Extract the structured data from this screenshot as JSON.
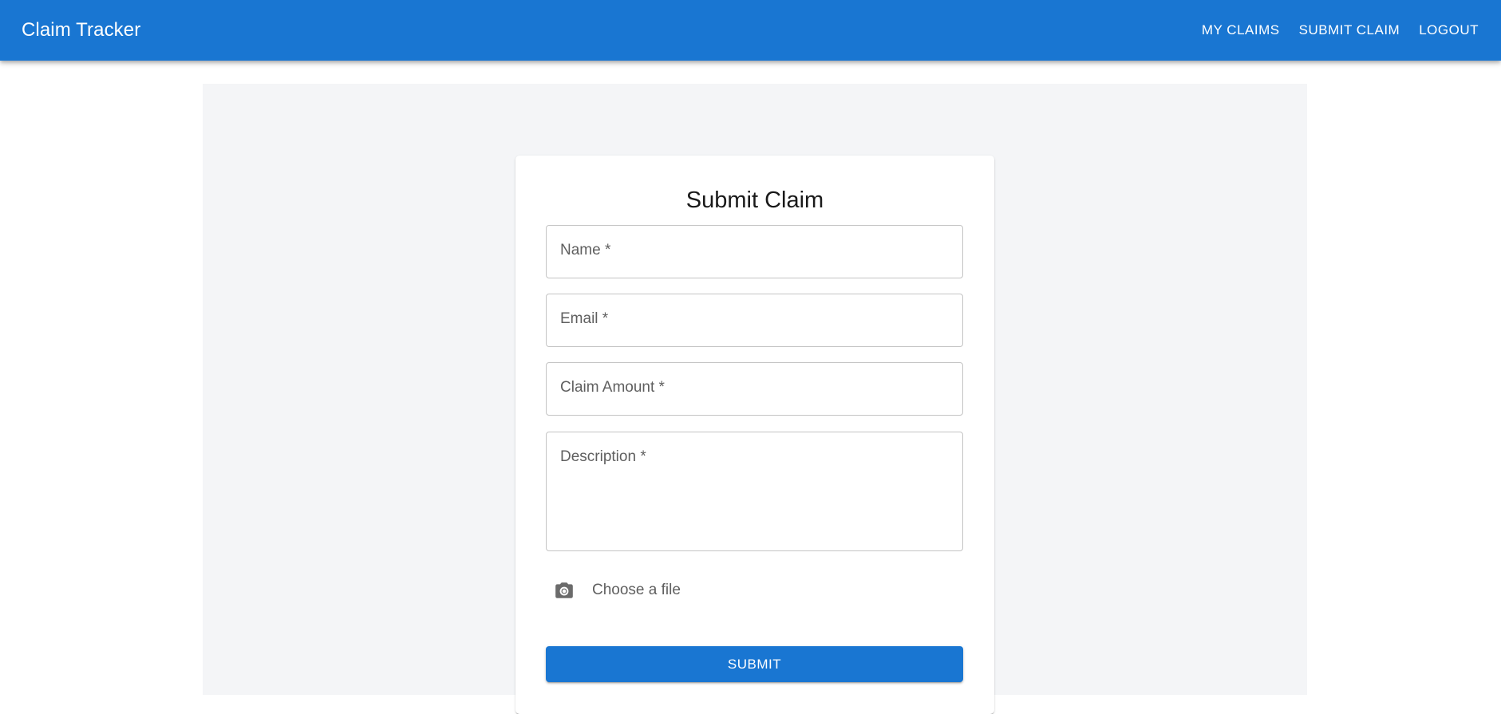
{
  "appbar": {
    "title": "Claim Tracker",
    "nav": [
      {
        "label": "MY CLAIMS"
      },
      {
        "label": "SUBMIT CLAIM"
      },
      {
        "label": "LOGOUT"
      }
    ],
    "color": "#1976d2"
  },
  "form": {
    "title": "Submit Claim",
    "fields": {
      "name": {
        "label": "Name *",
        "value": ""
      },
      "email": {
        "label": "Email *",
        "value": ""
      },
      "amount": {
        "label": "Claim Amount *",
        "value": ""
      },
      "description": {
        "label": "Description *",
        "value": ""
      }
    },
    "file_upload": {
      "icon": "camera-icon",
      "label": "Choose a file"
    },
    "submit_label": "SUBMIT"
  }
}
